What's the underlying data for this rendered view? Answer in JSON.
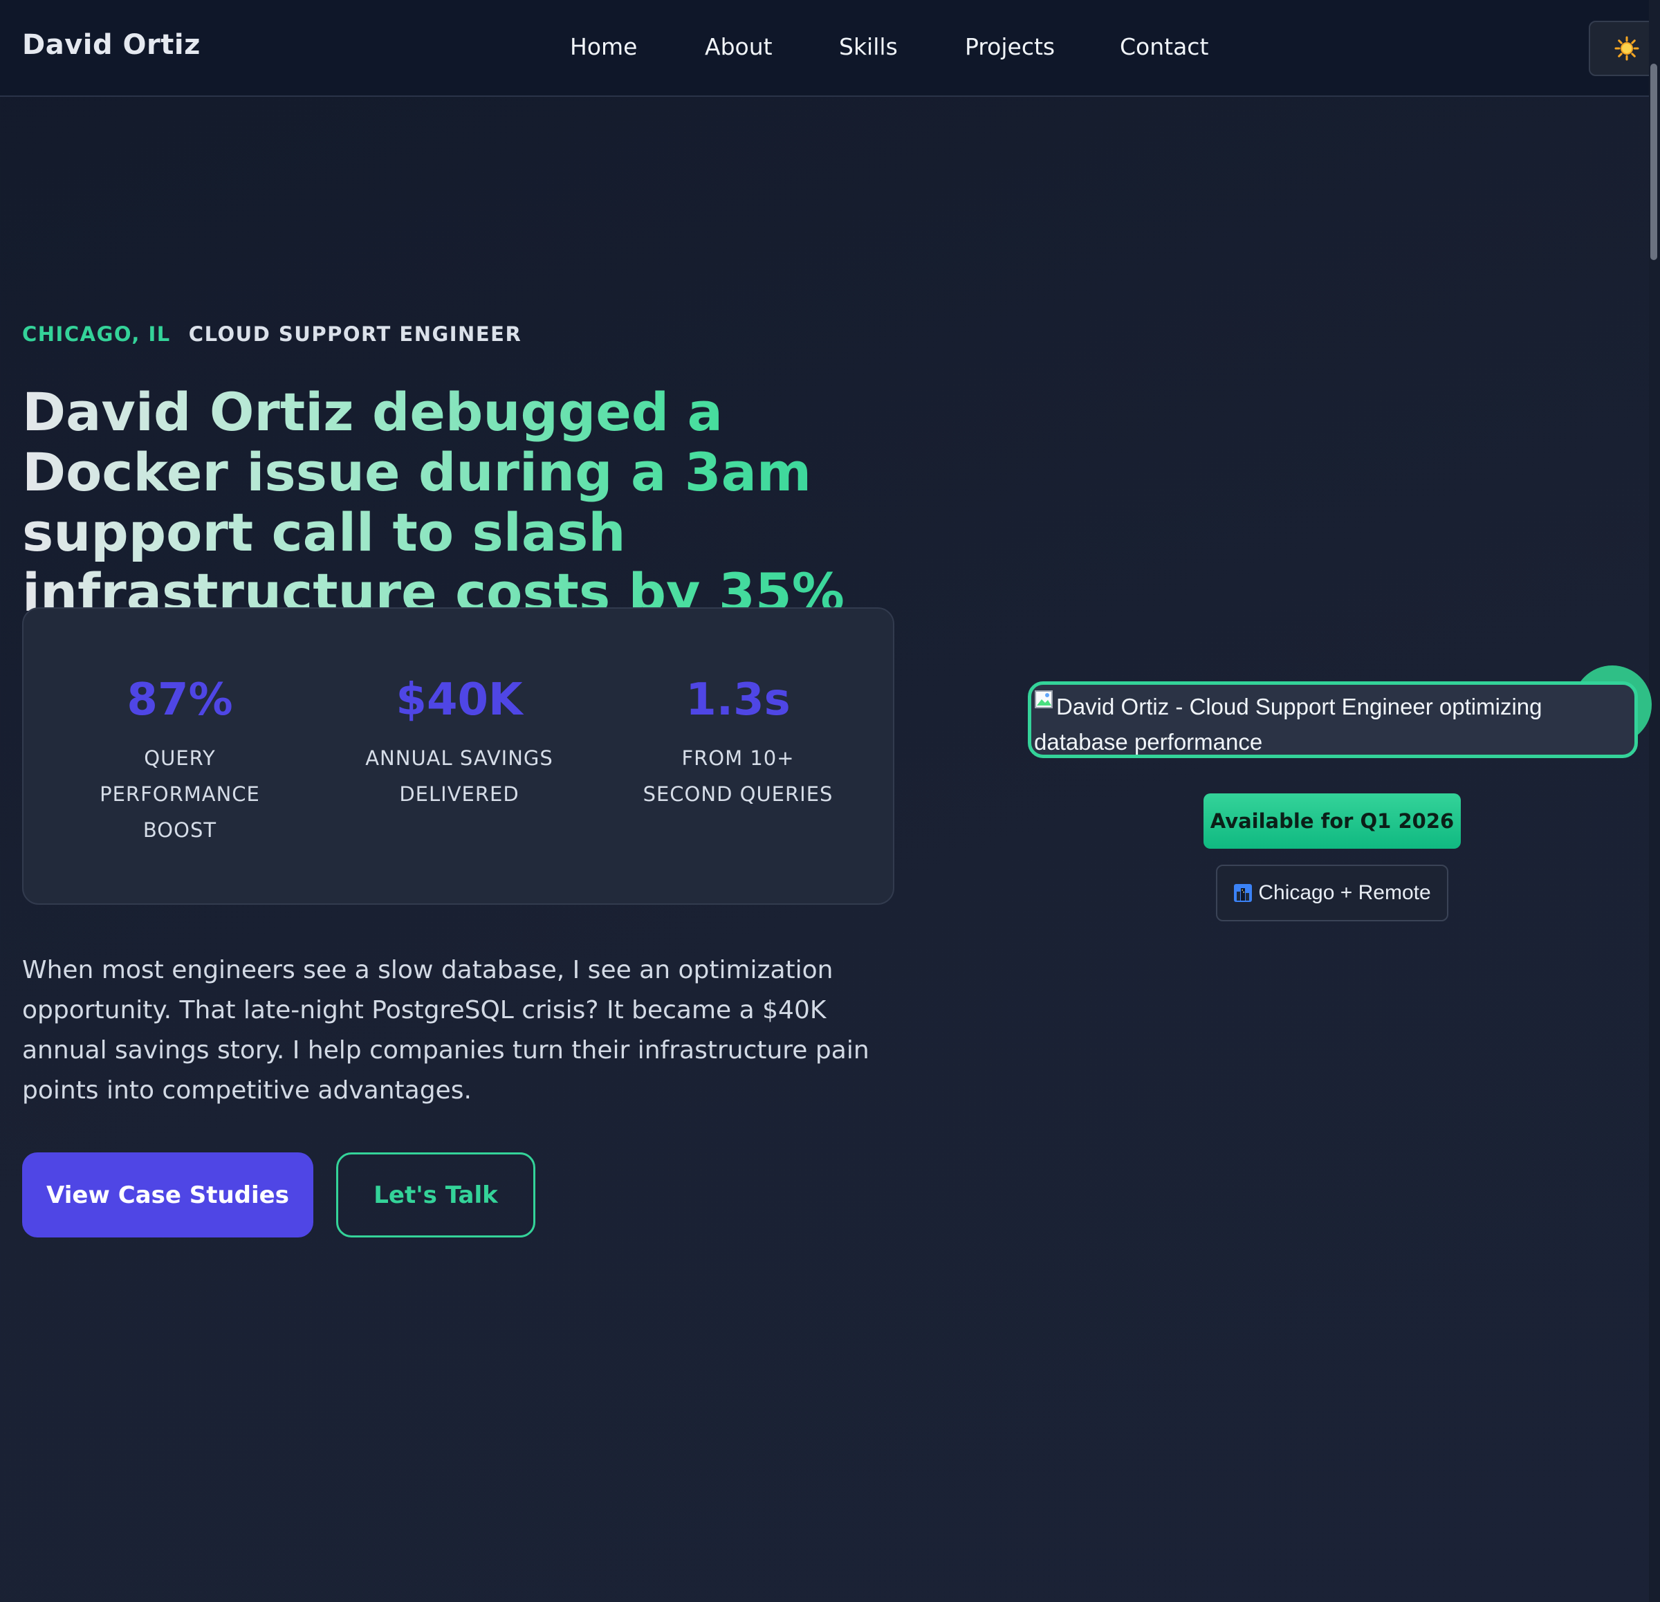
{
  "nav": {
    "brand": "David Ortiz",
    "links": [
      "Home",
      "About",
      "Skills",
      "Projects",
      "Contact"
    ],
    "theme_icon": "sun-icon"
  },
  "hero": {
    "location": "CHICAGO, IL",
    "role": "CLOUD SUPPORT ENGINEER",
    "headline": "David Ortiz debugged a Docker issue during a 3am support call to slash infrastructure costs by 35%",
    "stats": [
      {
        "value": "87%",
        "label": "QUERY PERFORMANCE BOOST"
      },
      {
        "value": "$40K",
        "label": "ANNUAL SAVINGS DELIVERED"
      },
      {
        "value": "1.3s",
        "label": "FROM 10+ SECOND QUERIES"
      }
    ],
    "intro": "When most engineers see a slow database, I see an optimization opportunity. That late-night PostgreSQL crisis? It became a $40K annual savings story. I help companies turn their infrastructure pain points into competitive advantages.",
    "primary_cta": "View Case Studies",
    "secondary_cta": "Let's Talk"
  },
  "profile": {
    "photo_alt": "David Ortiz - Cloud Support Engineer optimizing database performance",
    "availability": "Available for Q1 2026",
    "location_chip": "Chicago + Remote",
    "location_icon": "city-icon"
  },
  "colors": {
    "accent_green": "#34d399",
    "accent_indigo": "#4f46e5",
    "background": "#1a2133",
    "nav_background": "#0f1729"
  }
}
